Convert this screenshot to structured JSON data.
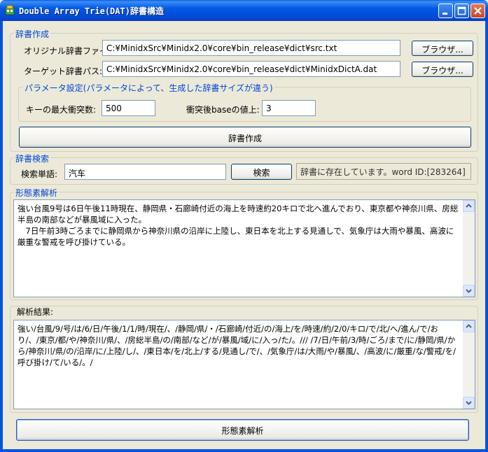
{
  "window": {
    "title": "Double Array Trie(DAT)辞書構造"
  },
  "dict_create": {
    "legend": "辞書作成",
    "original_label": "オリジナル辞書ファイル",
    "original_value": "C:¥MinidxSrc¥Minidx2.0¥core¥bin_release¥dict¥src.txt",
    "target_label": "ターゲット辞書パス:",
    "target_value": "C:¥MinidxSrc¥Minidx2.0¥core¥bin_release¥dict¥MinidxDictA.dat",
    "browse_label": "ブラウザ...",
    "params": {
      "legend": "パラメータ設定(パラメータによって、生成した辞書サイズが違う)",
      "max_collision_label": "キーの最大衝突数:",
      "max_collision_value": "500",
      "base_increment_label": "衝突後baseの値上:",
      "base_increment_value": "3"
    },
    "create_button": "辞書作成"
  },
  "dict_search": {
    "legend": "辞書検索",
    "word_label": "検索単語:",
    "word_value": "汽车",
    "search_button": "検索",
    "result_text": "辞書に存在しています。word ID:[283264]"
  },
  "morph": {
    "legend": "形態素解析",
    "input_text": "強い台風9号は6日午後11時現在、静岡県・石廊崎付近の海上を時速約20キロで北へ進んでおり、東京都や神奈川県、房総半島の南部などが暴風域に入った。\n　7日午前3時ごろまでに静岡県から神奈川県の沿岸に上陸し、東日本を北上する見通しで、気象庁は大雨や暴風、高波に厳重な警戒を呼び掛けている。",
    "result_label": "解析結果:",
    "result_text": "強い/台風/9/号/は/6/日/午後/1/1/時/現在/、/静岡/県/・/石廊崎/付近/の/海上/を/時速/約/2/0/キロ/で/北/へ/進ん/で/おり/、/東京/都/や/神奈川/県/、/房総半島/の/南部/など/が/暴風/域/に/入っ/た/。/// /7/日/午前/3/時/ごろ/まで/に/静岡/県/から/神奈川/県/の/沿岸/に/上陸/し/、/東日本/を/北上/する/見通し/で/、/気象庁/は/大雨/や/暴風/、/高波/に/厳重/な/警戒/を/呼び掛け/て/いる/。/",
    "analyze_button": "形態素解析"
  }
}
